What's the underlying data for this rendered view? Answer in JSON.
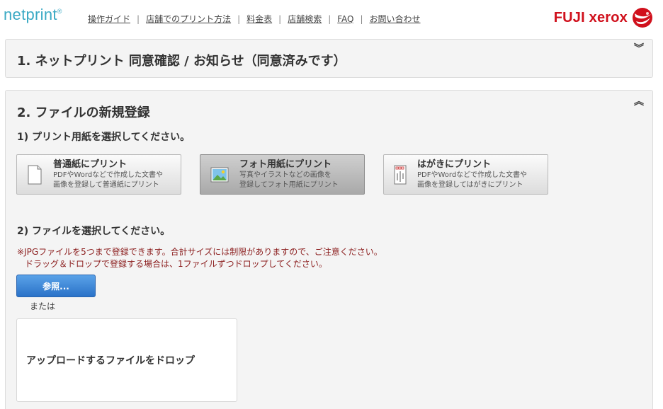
{
  "header": {
    "logo": "netprint",
    "logo_mark": "®",
    "nav": [
      "操作ガイド",
      "店舗でのプリント方法",
      "料金表",
      "店舗検索",
      "FAQ",
      "お問い合わせ"
    ],
    "nav_separator": "|",
    "brand": "FUJI xerox"
  },
  "section1": {
    "title": "1. ネットプリント 同意確認 / お知らせ（同意済みです）",
    "toggle_icon": "chevron-down-icon"
  },
  "section2": {
    "title": "2. ファイルの新規登録",
    "toggle_icon": "chevron-up-icon",
    "step1_label": "1) プリント用紙を選択してください。",
    "options": [
      {
        "title": "普通紙にプリント",
        "desc1": "PDFやWordなどで作成した文書や",
        "desc2": "画像を登録して普通紙にプリント",
        "icon": "document-icon"
      },
      {
        "title": "フォト用紙にプリント",
        "desc1": "写真やイラストなどの画像を",
        "desc2": "登録してフォト用紙にプリント",
        "icon": "photo-icon",
        "selected": true
      },
      {
        "title": "はがきにプリント",
        "desc1": "PDFやWordなどで作成した文書や",
        "desc2": "画像を登録してはがきにプリント",
        "icon": "postcard-icon"
      }
    ],
    "step2_label": "2) ファイルを選択してください。",
    "notice_line1": "※JPGファイルを5つまで登録できます。合計サイズには制限がありますので、ご注意ください。",
    "notice_line2": "ドラッグ＆ドロップで登録する場合は、1ファイルずつドロップしてください。",
    "browse_button": "参照...",
    "or_text": "または",
    "drop_zone_label": "アップロードするファイルをドロップ"
  },
  "colors": {
    "logo": "#3aa9c4",
    "brand": "#d0101c",
    "notice": "#8b1d1d",
    "browse_button": "#2a72c8"
  }
}
